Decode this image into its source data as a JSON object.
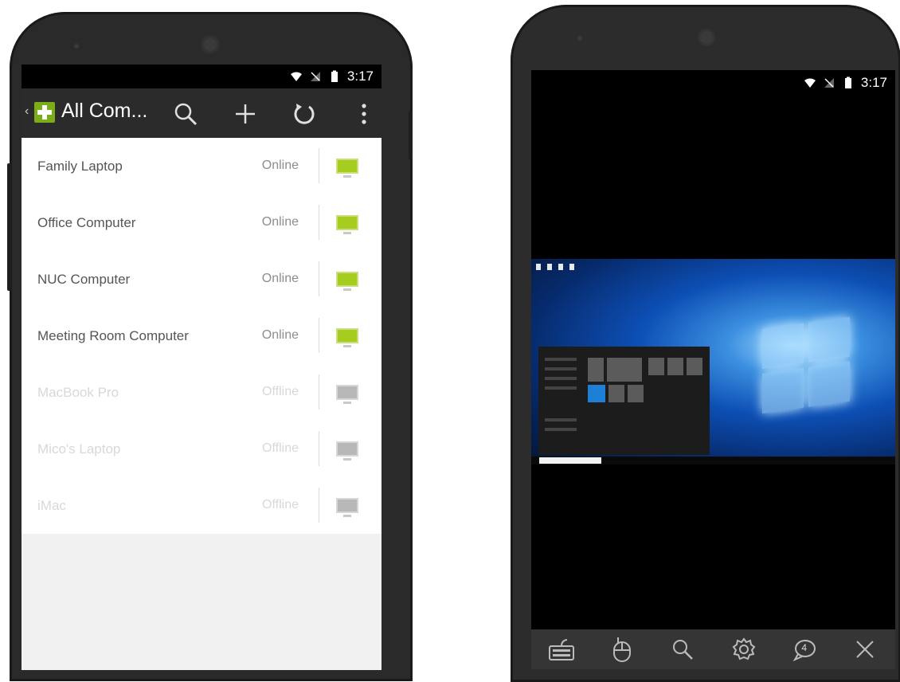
{
  "left_phone": {
    "status_bar": {
      "time": "3:17",
      "icons": [
        "wifi-icon",
        "no-signal-icon",
        "battery-icon"
      ]
    },
    "app_bar": {
      "back_glyph": "‹",
      "title": "All Com...",
      "actions": [
        "search-icon",
        "add-icon",
        "refresh-icon",
        "overflow-menu-icon"
      ]
    },
    "computers": [
      {
        "name": "Family Laptop",
        "status": "Online"
      },
      {
        "name": "Office Computer",
        "status": "Online"
      },
      {
        "name": "NUC Computer",
        "status": "Online"
      },
      {
        "name": "Meeting Room Computer",
        "status": "Online"
      },
      {
        "name": "MacBook Pro",
        "status": "Offline"
      },
      {
        "name": "Mico's Laptop",
        "status": "Offline"
      },
      {
        "name": "iMac",
        "status": "Offline"
      }
    ],
    "colors": {
      "online_monitor": "#a6cc20",
      "offline_monitor": "#b8b8b8",
      "app_bar": "#2b2b2b",
      "logo": "#7aad18"
    }
  },
  "right_phone": {
    "status_bar": {
      "time": "3:17",
      "icons": [
        "wifi-icon",
        "no-signal-icon",
        "battery-icon"
      ]
    },
    "remote_desktop": {
      "os": "Windows 10 desktop with start menu open"
    },
    "toolbar": {
      "items": [
        "keyboard-icon",
        "mouse-icon",
        "zoom-icon",
        "settings-icon",
        "chat-icon",
        "close-icon"
      ],
      "chat_badge": "4"
    }
  }
}
